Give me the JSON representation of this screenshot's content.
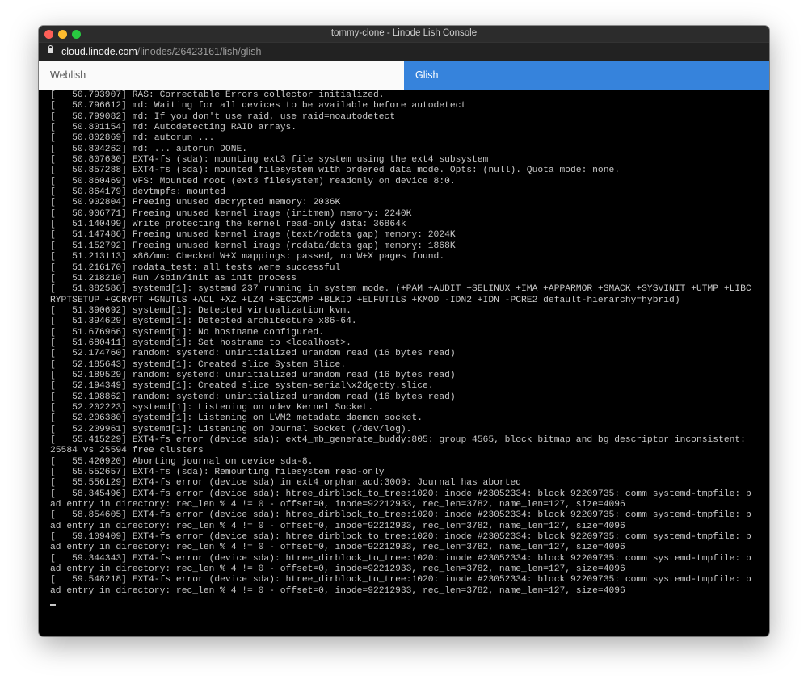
{
  "window": {
    "title": "tommy-clone - Linode Lish Console",
    "url_host": "cloud.linode.com",
    "url_path": "/linodes/26423161/lish/glish",
    "colors": {
      "close": "#ff5f57",
      "minimize": "#febc2e",
      "maximize": "#28c840",
      "accent": "#3683dc"
    }
  },
  "tabs": [
    {
      "label": "Weblish",
      "active": false
    },
    {
      "label": "Glish",
      "active": true
    }
  ],
  "console": {
    "lines": [
      "[   50.793907] RAS: Correctable Errors collector initialized.",
      "[   50.796612] md: Waiting for all devices to be available before autodetect",
      "[   50.799082] md: If you don't use raid, use raid=noautodetect",
      "[   50.801154] md: Autodetecting RAID arrays.",
      "[   50.802869] md: autorun ...",
      "[   50.804262] md: ... autorun DONE.",
      "[   50.807630] EXT4-fs (sda): mounting ext3 file system using the ext4 subsystem",
      "[   50.857288] EXT4-fs (sda): mounted filesystem with ordered data mode. Opts: (null). Quota mode: none.",
      "[   50.860469] VFS: Mounted root (ext3 filesystem) readonly on device 8:0.",
      "[   50.864179] devtmpfs: mounted",
      "[   50.902804] Freeing unused decrypted memory: 2036K",
      "[   50.906771] Freeing unused kernel image (initmem) memory: 2240K",
      "[   51.140499] Write protecting the kernel read-only data: 36864k",
      "[   51.147486] Freeing unused kernel image (text/rodata gap) memory: 2024K",
      "[   51.152792] Freeing unused kernel image (rodata/data gap) memory: 1868K",
      "[   51.213113] x86/mm: Checked W+X mappings: passed, no W+X pages found.",
      "[   51.216170] rodata_test: all tests were successful",
      "[   51.218210] Run /sbin/init as init process",
      "[   51.382586] systemd[1]: systemd 237 running in system mode. (+PAM +AUDIT +SELINUX +IMA +APPARMOR +SMACK +SYSVINIT +UTMP +LIBCRYPTSETUP +GCRYPT +GNUTLS +ACL +XZ +LZ4 +SECCOMP +BLKID +ELFUTILS +KMOD -IDN2 +IDN -PCRE2 default-hierarchy=hybrid)",
      "[   51.390692] systemd[1]: Detected virtualization kvm.",
      "[   51.394629] systemd[1]: Detected architecture x86-64.",
      "[   51.676966] systemd[1]: No hostname configured.",
      "[   51.680411] systemd[1]: Set hostname to <localhost>.",
      "[   52.174760] random: systemd: uninitialized urandom read (16 bytes read)",
      "[   52.185643] systemd[1]: Created slice System Slice.",
      "[   52.189529] random: systemd: uninitialized urandom read (16 bytes read)",
      "[   52.194349] systemd[1]: Created slice system-serial\\x2dgetty.slice.",
      "[   52.198862] random: systemd: uninitialized urandom read (16 bytes read)",
      "[   52.202223] systemd[1]: Listening on udev Kernel Socket.",
      "[   52.206380] systemd[1]: Listening on LVM2 metadata daemon socket.",
      "[   52.209961] systemd[1]: Listening on Journal Socket (/dev/log).",
      "[   55.415229] EXT4-fs error (device sda): ext4_mb_generate_buddy:805: group 4565, block bitmap and bg descriptor inconsistent: 25584 vs 25594 free clusters",
      "[   55.420920] Aborting journal on device sda-8.",
      "[   55.552657] EXT4-fs (sda): Remounting filesystem read-only",
      "[   55.556129] EXT4-fs error (device sda) in ext4_orphan_add:3009: Journal has aborted",
      "[   58.345496] EXT4-fs error (device sda): htree_dirblock_to_tree:1020: inode #23052334: block 92209735: comm systemd-tmpfile: bad entry in directory: rec_len % 4 != 0 - offset=0, inode=92212933, rec_len=3782, name_len=127, size=4096",
      "[   58.854605] EXT4-fs error (device sda): htree_dirblock_to_tree:1020: inode #23052334: block 92209735: comm systemd-tmpfile: bad entry in directory: rec_len % 4 != 0 - offset=0, inode=92212933, rec_len=3782, name_len=127, size=4096",
      "[   59.109409] EXT4-fs error (device sda): htree_dirblock_to_tree:1020: inode #23052334: block 92209735: comm systemd-tmpfile: bad entry in directory: rec_len % 4 != 0 - offset=0, inode=92212933, rec_len=3782, name_len=127, size=4096",
      "[   59.344343] EXT4-fs error (device sda): htree_dirblock_to_tree:1020: inode #23052334: block 92209735: comm systemd-tmpfile: bad entry in directory: rec_len % 4 != 0 - offset=0, inode=92212933, rec_len=3782, name_len=127, size=4096",
      "[   59.548218] EXT4-fs error (device sda): htree_dirblock_to_tree:1020: inode #23052334: block 92209735: comm systemd-tmpfile: bad entry in directory: rec_len % 4 != 0 - offset=0, inode=92212933, rec_len=3782, name_len=127, size=4096",
      ""
    ]
  }
}
